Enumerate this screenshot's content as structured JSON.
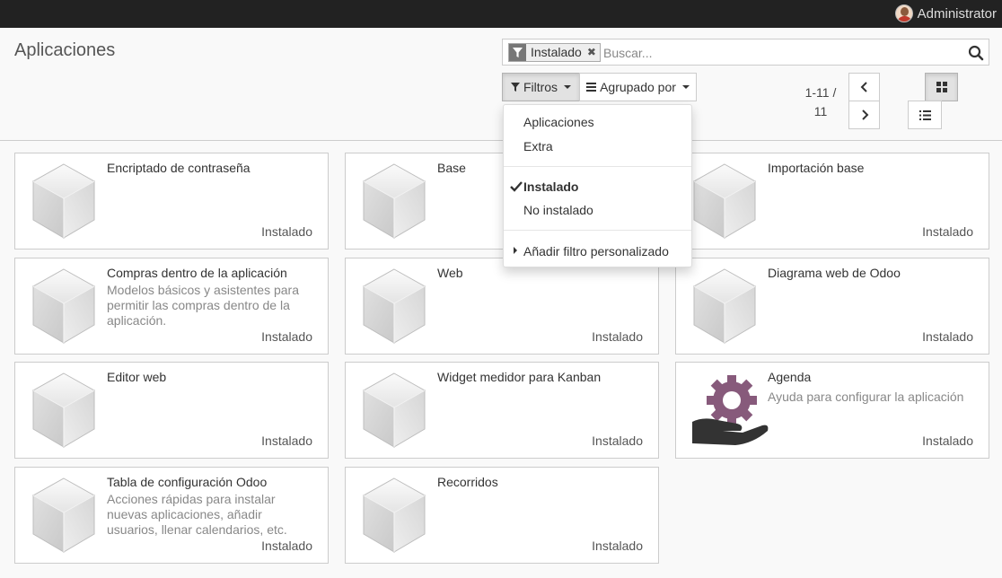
{
  "topbar": {
    "user": "Administrator"
  },
  "page": {
    "title": "Aplicaciones"
  },
  "search": {
    "facet": "Instalado",
    "facet_remove": "✖",
    "placeholder": "Buscar..."
  },
  "buttons": {
    "filters": "Filtros",
    "groupby": "Agrupado por"
  },
  "pager": {
    "range": "1-11 /",
    "total": "11"
  },
  "filters_menu": {
    "items": [
      "Aplicaciones",
      "Extra"
    ],
    "state_items": [
      "Instalado",
      "No instalado"
    ],
    "selected": "Instalado",
    "custom": "Añadir filtro personalizado"
  },
  "icons": {
    "default": "cube-icon",
    "agenda": "hand-gear-icon",
    "agenda_color": "#875a7b"
  },
  "apps": [
    {
      "name": "Encriptado de contraseña",
      "desc": "",
      "status": "Instalado"
    },
    {
      "name": "Base",
      "desc": "",
      "status": "Instalado"
    },
    {
      "name": "Importación base",
      "desc": "",
      "status": "Instalado"
    },
    {
      "name": "Compras dentro de la aplicación",
      "desc": "Modelos básicos y asistentes para permitir las compras dentro de la aplicación.",
      "status": "Instalado"
    },
    {
      "name": "Web",
      "desc": "",
      "status": "Instalado"
    },
    {
      "name": "Diagrama web de Odoo",
      "desc": "",
      "status": "Instalado"
    },
    {
      "name": "Editor web",
      "desc": "",
      "status": "Instalado"
    },
    {
      "name": "Widget medidor para Kanban",
      "desc": "",
      "status": "Instalado"
    },
    {
      "name": "Agenda",
      "desc": "Ayuda para configurar la aplicación",
      "status": "Instalado"
    },
    {
      "name": "Tabla de configuración Odoo",
      "desc": "Acciones rápidas para instalar nuevas aplicaciones, añadir usuarios, llenar calendarios, etc.",
      "status": "Instalado"
    },
    {
      "name": "Recorridos",
      "desc": "",
      "status": "Instalado"
    }
  ]
}
